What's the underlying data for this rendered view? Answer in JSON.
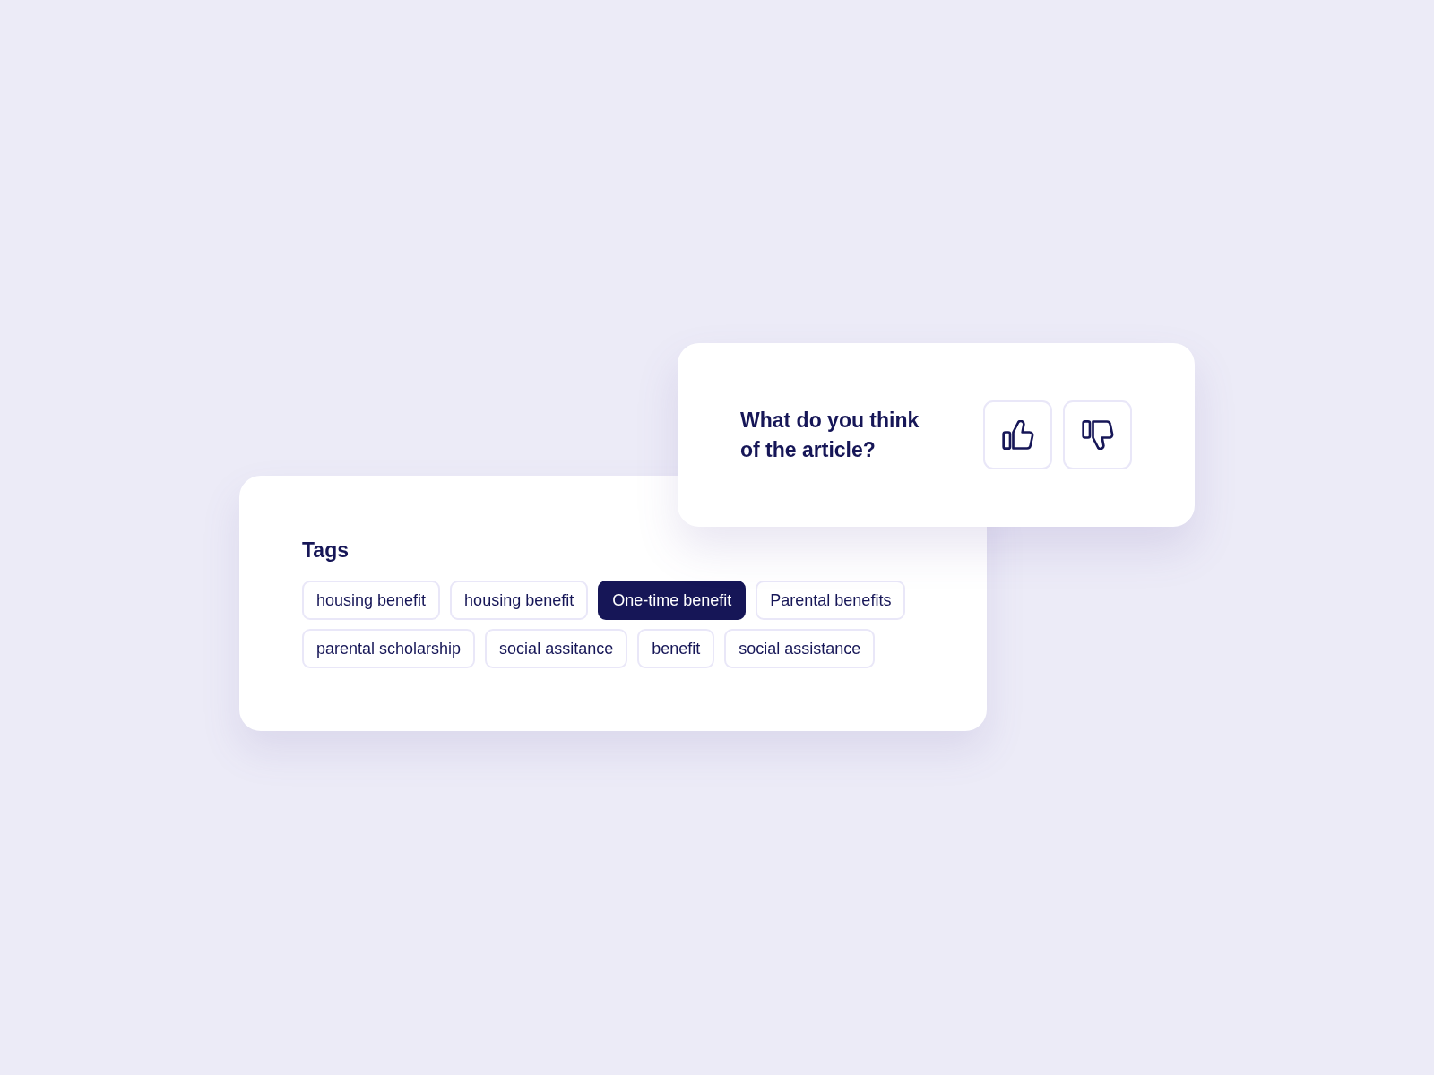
{
  "feedback": {
    "question": "What do you think of the article?",
    "buttons": [
      {
        "kind": "thumbs_up"
      },
      {
        "kind": "thumbs_down"
      }
    ]
  },
  "tags": {
    "title": "Tags",
    "items": [
      {
        "label": "housing benefit",
        "selected": false
      },
      {
        "label": "housing benefit",
        "selected": false
      },
      {
        "label": "One-time benefit",
        "selected": true
      },
      {
        "label": "Parental benefits",
        "selected": false
      },
      {
        "label": "parental scholarship",
        "selected": false
      },
      {
        "label": "social assitance",
        "selected": false
      },
      {
        "label": "benefit",
        "selected": false
      },
      {
        "label": "social assistance",
        "selected": false
      }
    ]
  }
}
